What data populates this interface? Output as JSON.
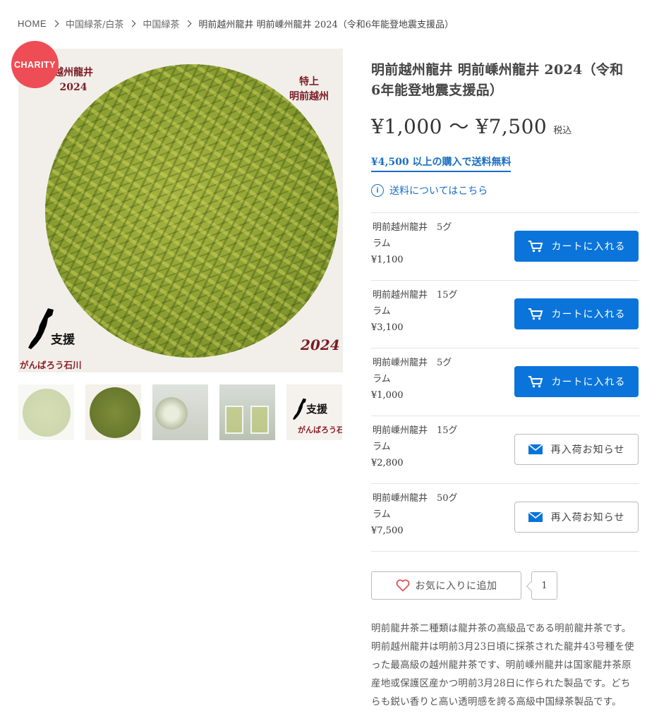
{
  "breadcrumb": {
    "home": "HOME",
    "level1": "中国緑茶/白茶",
    "level2": "中国緑茶",
    "current": "明前越州龍井 明前嵊州龍井 2024（令和6年能登地震支援品）"
  },
  "badge": {
    "label": "CHARITY",
    "color": "#ef4d55"
  },
  "main_image": {
    "top_left_line1": "越州龍井",
    "top_left_line2": "2024",
    "top_right_line1": "特上",
    "top_right_line2": "明前越州",
    "support": "支援",
    "slogan": "がんばろう石川",
    "year": "2024"
  },
  "thumbnails": {
    "t5_support": "支援",
    "t5_slogan": "がんばろう石川"
  },
  "product": {
    "title": "明前越州龍井 明前嵊州龍井 2024（令和6年能登地震支援品）",
    "price_range": "¥1,000 〜 ¥7,500",
    "tax_label": "税込",
    "free_shipping": "¥4,500 以上の購入で送料無料",
    "shipping_link": "送料についてはこちら"
  },
  "variants": [
    {
      "name": "明前越州龍井　5グラム",
      "price": "¥1,100",
      "button": "カートに入れる",
      "type": "cart"
    },
    {
      "name": "明前越州龍井　15グラム",
      "price": "¥3,100",
      "button": "カートに入れる",
      "type": "cart"
    },
    {
      "name": "明前嵊州龍井　5グラム",
      "price": "¥1,000",
      "button": "カートに入れる",
      "type": "cart"
    },
    {
      "name": "明前嵊州龍井　15グラム",
      "price": "¥2,800",
      "button": "再入荷お知らせ",
      "type": "notify"
    },
    {
      "name": "明前嵊州龍井　50グラム",
      "price": "¥7,500",
      "button": "再入荷お知らせ",
      "type": "notify"
    }
  ],
  "favorite": {
    "label": "お気に入りに追加",
    "count": "1"
  },
  "description": "明前龍井茶二種類は龍井茶の高級品である明前龍井茶です。明前越州龍井は明前3月23日頃に採茶された龍井43号種を使った最高級の越州龍井茶です、明前嵊州龍井は国家龍井茶原産地或保護区産かつ明前3月28日に作られた製品です。どちらも鋭い香りと高い透明感を誇る高級中国緑茶製品です。",
  "colors": {
    "accent": "#0a74da",
    "link": "#1a6fc4",
    "badge": "#ef4d55"
  }
}
